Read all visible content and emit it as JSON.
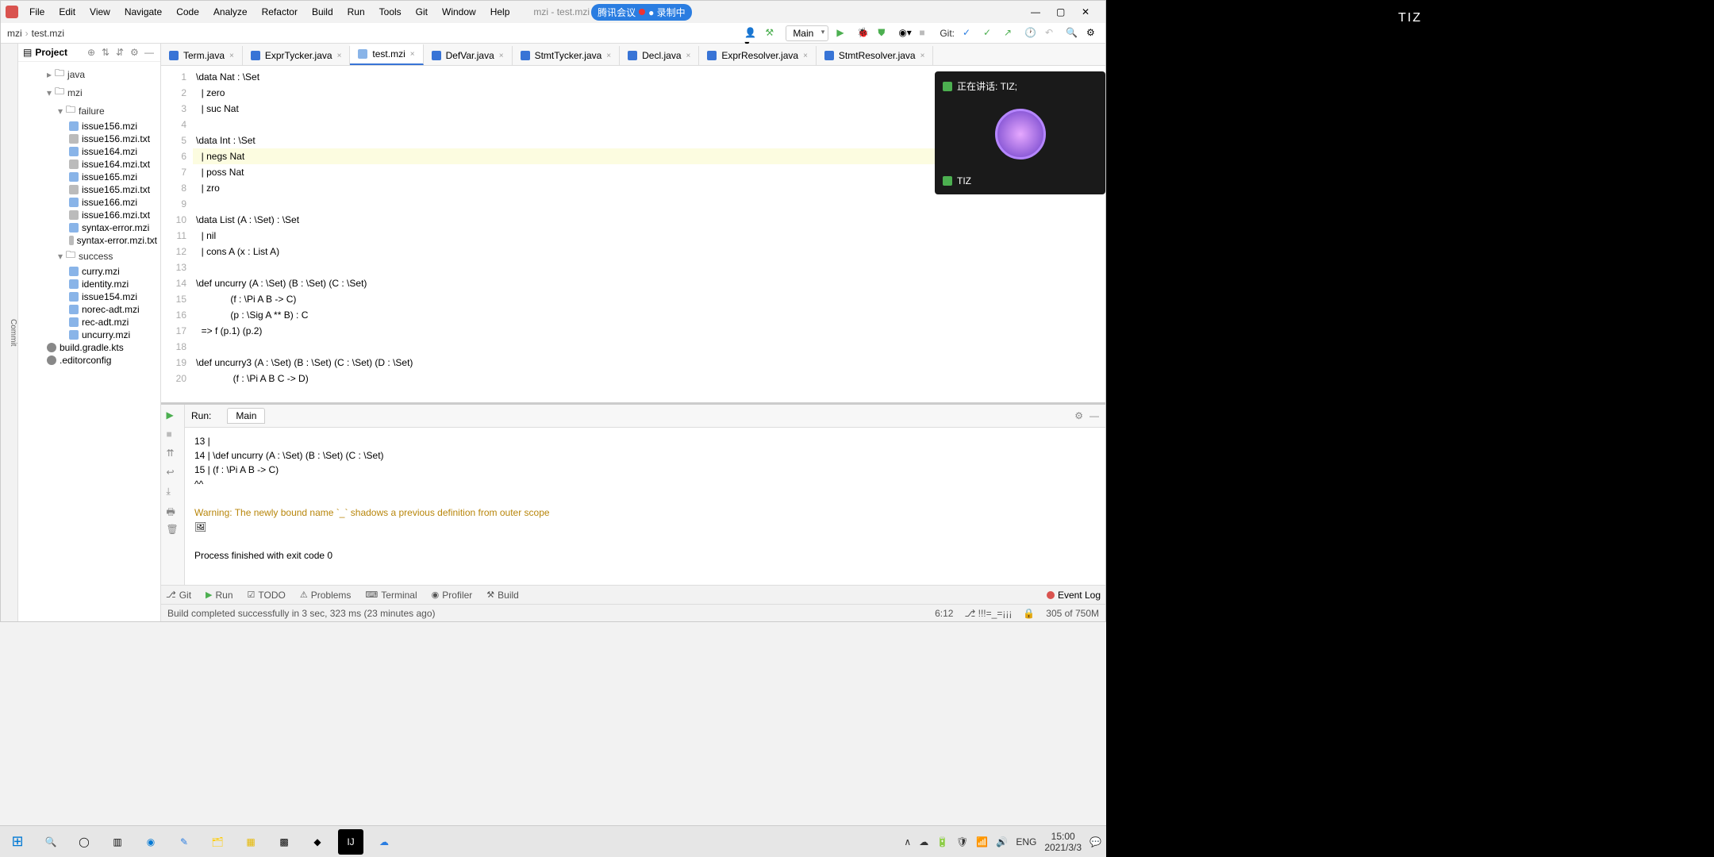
{
  "menubar": [
    "File",
    "Edit",
    "View",
    "Navigate",
    "Code",
    "Analyze",
    "Refactor",
    "Build",
    "Run",
    "Tools",
    "Git",
    "Window",
    "Help"
  ],
  "window_title": "mzi - test.mzi",
  "recording": {
    "app": "腾讯会议",
    "status": "● 录制中"
  },
  "breadcrumb": [
    "mzi",
    "test.mzi"
  ],
  "run_config": "Main",
  "git_label": "Git:",
  "project": {
    "title": "Project",
    "tree": [
      {
        "label": "java",
        "type": "folder",
        "open": false,
        "indent": 1
      },
      {
        "label": "mzi",
        "type": "folder",
        "open": true,
        "indent": 1
      },
      {
        "label": "failure",
        "type": "folder",
        "open": true,
        "indent": 2
      },
      {
        "label": "issue156.mzi",
        "type": "mzi",
        "indent": 3
      },
      {
        "label": "issue156.mzi.txt",
        "type": "txt",
        "indent": 3
      },
      {
        "label": "issue164.mzi",
        "type": "mzi",
        "indent": 3
      },
      {
        "label": "issue164.mzi.txt",
        "type": "txt",
        "indent": 3
      },
      {
        "label": "issue165.mzi",
        "type": "mzi",
        "indent": 3
      },
      {
        "label": "issue165.mzi.txt",
        "type": "txt",
        "indent": 3
      },
      {
        "label": "issue166.mzi",
        "type": "mzi",
        "indent": 3
      },
      {
        "label": "issue166.mzi.txt",
        "type": "txt",
        "indent": 3
      },
      {
        "label": "syntax-error.mzi",
        "type": "mzi",
        "indent": 3
      },
      {
        "label": "syntax-error.mzi.txt",
        "type": "txt",
        "indent": 3
      },
      {
        "label": "success",
        "type": "folder",
        "open": true,
        "indent": 2
      },
      {
        "label": "curry.mzi",
        "type": "mzi",
        "indent": 3
      },
      {
        "label": "identity.mzi",
        "type": "mzi",
        "indent": 3
      },
      {
        "label": "issue154.mzi",
        "type": "mzi",
        "indent": 3
      },
      {
        "label": "norec-adt.mzi",
        "type": "mzi",
        "indent": 3
      },
      {
        "label": "rec-adt.mzi",
        "type": "mzi",
        "indent": 3
      },
      {
        "label": "uncurry.mzi",
        "type": "mzi",
        "indent": 3
      },
      {
        "label": "build.gradle.kts",
        "type": "config",
        "indent": 1
      },
      {
        "label": ".editorconfig",
        "type": "config",
        "indent": 1
      }
    ]
  },
  "tabs": [
    {
      "label": "Term.java",
      "type": "java"
    },
    {
      "label": "ExprTycker.java",
      "type": "java"
    },
    {
      "label": "test.mzi",
      "type": "mzi",
      "active": true
    },
    {
      "label": "DefVar.java",
      "type": "java"
    },
    {
      "label": "StmtTycker.java",
      "type": "java"
    },
    {
      "label": "Decl.java",
      "type": "java"
    },
    {
      "label": "ExprResolver.java",
      "type": "java"
    },
    {
      "label": "StmtResolver.java",
      "type": "java"
    }
  ],
  "code_lines": [
    "\\data Nat : \\Set",
    "  | zero",
    "  | suc Nat",
    "",
    "\\data Int : \\Set",
    "  | negs Nat",
    "  | poss Nat",
    "  | zro",
    "",
    "\\data List (A : \\Set) : \\Set",
    "  | nil",
    "  | cons A (x : List A)",
    "",
    "\\def uncurry (A : \\Set) (B : \\Set) (C : \\Set)",
    "             (f : \\Pi A B -> C)",
    "             (p : \\Sig A ** B) : C",
    "  => f (p.1) (p.2)",
    "",
    "\\def uncurry3 (A : \\Set) (B : \\Set) (C : \\Set) (D : \\Set)",
    "              (f : \\Pi A B C -> D)"
  ],
  "run": {
    "label": "Run:",
    "tab": "Main",
    "output_lines": [
      " 13 |",
      " 14 | \\def uncurry (A : \\Set) (B : \\Set) (C : \\Set)",
      " 15 |              (f : \\Pi A B -> C)",
      "                           ^^"
    ],
    "warning": "Warning: The newly bound name `_` shadows a previous definition from outer scope",
    "exit": "Process finished with exit code 0"
  },
  "bottom_tabs": [
    "Git",
    "Run",
    "TODO",
    "Problems",
    "Terminal",
    "Profiler",
    "Build"
  ],
  "event_log": "Event Log",
  "statusbar": {
    "build": "Build completed successfully in 3 sec, 323 ms (23 minutes ago)",
    "pos": "6:12",
    "branch": "!!!=_=¡¡¡",
    "heap": "305 of 750M"
  },
  "taskbar": {
    "tray": [
      "∧",
      "☁",
      "🔋",
      "🛡",
      "📶",
      "🔊"
    ],
    "ime": "ENG",
    "time": "15:00",
    "date": "2021/3/3"
  },
  "rpanel": {
    "title": "TIZ"
  },
  "overlay": {
    "speaking": "正在讲话: TIZ;",
    "user": "TIZ"
  }
}
